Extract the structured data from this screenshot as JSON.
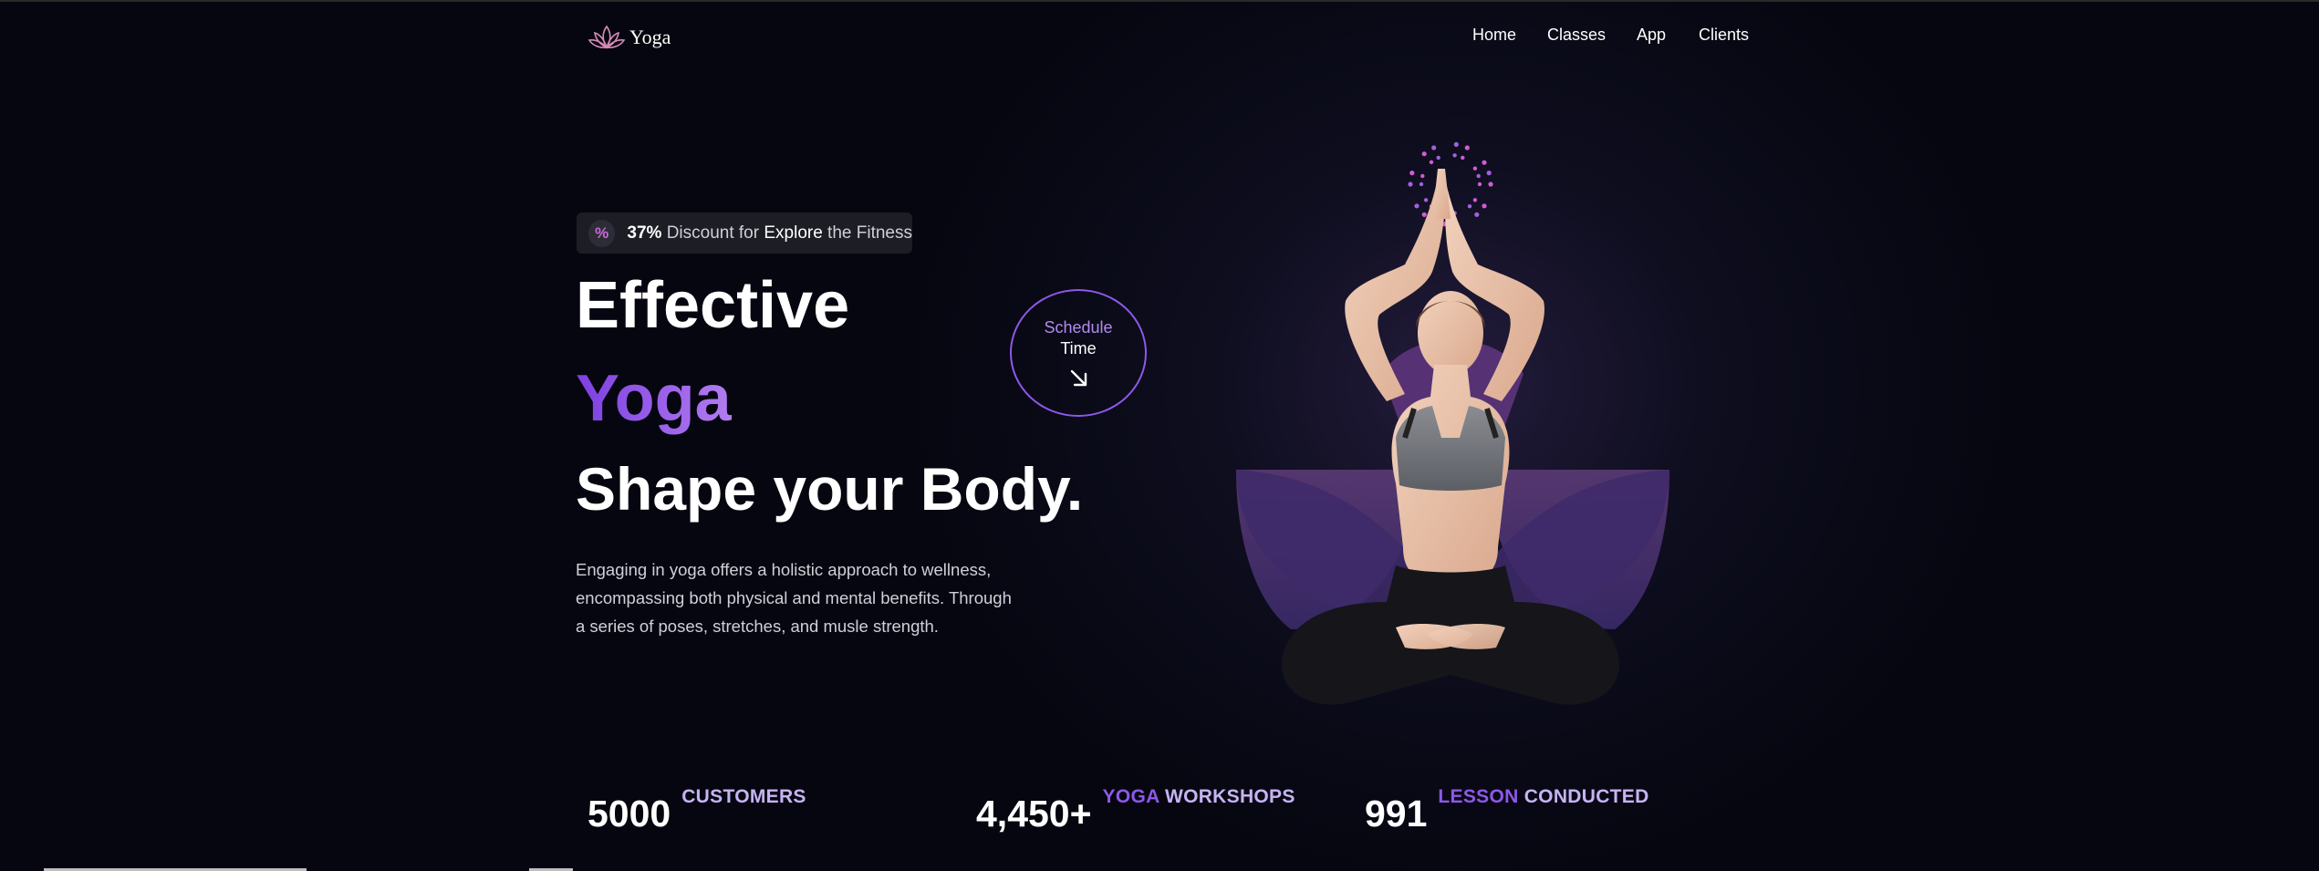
{
  "header": {
    "logo_text": "Yoga",
    "logo_icon": "lotus-icon",
    "nav": [
      "Home",
      "Classes",
      "App",
      "Clients"
    ]
  },
  "promo": {
    "icon": "percent-icon",
    "percent": "37%",
    "text1": " Discount for ",
    "highlight": "Explore",
    "text2": " the Fitness"
  },
  "hero": {
    "line1": "Effective",
    "line2": "Yoga",
    "line3": "Shape your Body.",
    "description": "Engaging in yoga offers a holistic approach to wellness, encompassing both physical and mental benefits. Through a series of poses, stretches, and musle strength."
  },
  "schedule": {
    "line1": "Schedule",
    "line2": "Time",
    "icon": "arrow-down-right-icon"
  },
  "stats": [
    {
      "value": "5000",
      "label_primary": "",
      "label_secondary": "CUSTOMERS"
    },
    {
      "value": "4,450+",
      "label_primary": "YOGA",
      "label_secondary": "WORKSHOPS"
    },
    {
      "value": "991",
      "label_primary": "LESSON",
      "label_secondary": "CONDUCTED"
    }
  ],
  "colors": {
    "background": "#05060f",
    "accent": "#8e58e8",
    "accent_light": "#c7b3f3",
    "pink": "#d35ad8"
  }
}
